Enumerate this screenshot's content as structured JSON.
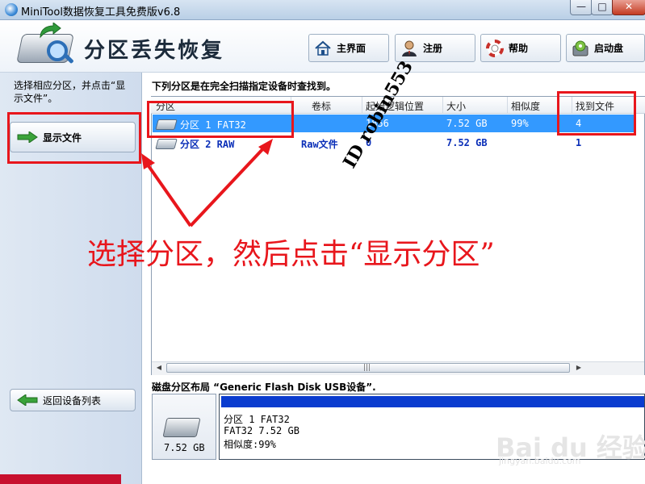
{
  "window": {
    "title": "MiniTool数据恢复工具免费版v6.8",
    "controls": {
      "minimize": "—",
      "maximize": "□",
      "close": "✕"
    }
  },
  "header": {
    "app_name": "分区丢失恢复",
    "buttons": [
      {
        "label": "主界面",
        "icon": "home-icon"
      },
      {
        "label": "注册",
        "icon": "user-icon"
      },
      {
        "label": "帮助",
        "icon": "lifebuoy-icon"
      },
      {
        "label": "启动盘",
        "icon": "boot-disc-icon"
      }
    ]
  },
  "sidebar": {
    "hint": "选择相应分区，并点击“显示文件”。",
    "show_files_button": "显示文件",
    "back_button": "返回设备列表"
  },
  "main": {
    "caption": "下列分区是在完全扫描指定设备时查找到。",
    "columns": [
      "分区",
      "卷标",
      "起始逻辑位置",
      "大小",
      "相似度",
      "找到文件"
    ],
    "rows": [
      {
        "partition": "分区 1 FAT32",
        "label": "",
        "start": "1856",
        "size": "7.52 GB",
        "similarity": "99%",
        "found": "4",
        "selected": true
      },
      {
        "partition": "分区 2 RAW",
        "label": "Raw文件",
        "start": "0",
        "size": "7.52 GB",
        "similarity": "",
        "found": "1",
        "selected": false
      }
    ],
    "scrollbar": {
      "grip": "|||"
    }
  },
  "disk_layout": {
    "caption": "磁盘分区布局 “Generic Flash Disk USB设备”.",
    "disk_size": "7.52 GB",
    "partition": {
      "line1": "分区 1 FAT32",
      "line2": "FAT32 7.52 GB",
      "line3": "相似度:99%"
    }
  },
  "annotation": {
    "note": "选择分区，然后点击“显示分区”",
    "color": "#e8161c"
  },
  "watermark": {
    "id": "ID robin553",
    "baidu": "Bai du 经验",
    "baidu_sub": "jingyan.baidu.com"
  },
  "colors": {
    "selection": "#3399ff",
    "partition_bar": "#0a3ccf",
    "row_text": "#0b2fb8"
  }
}
